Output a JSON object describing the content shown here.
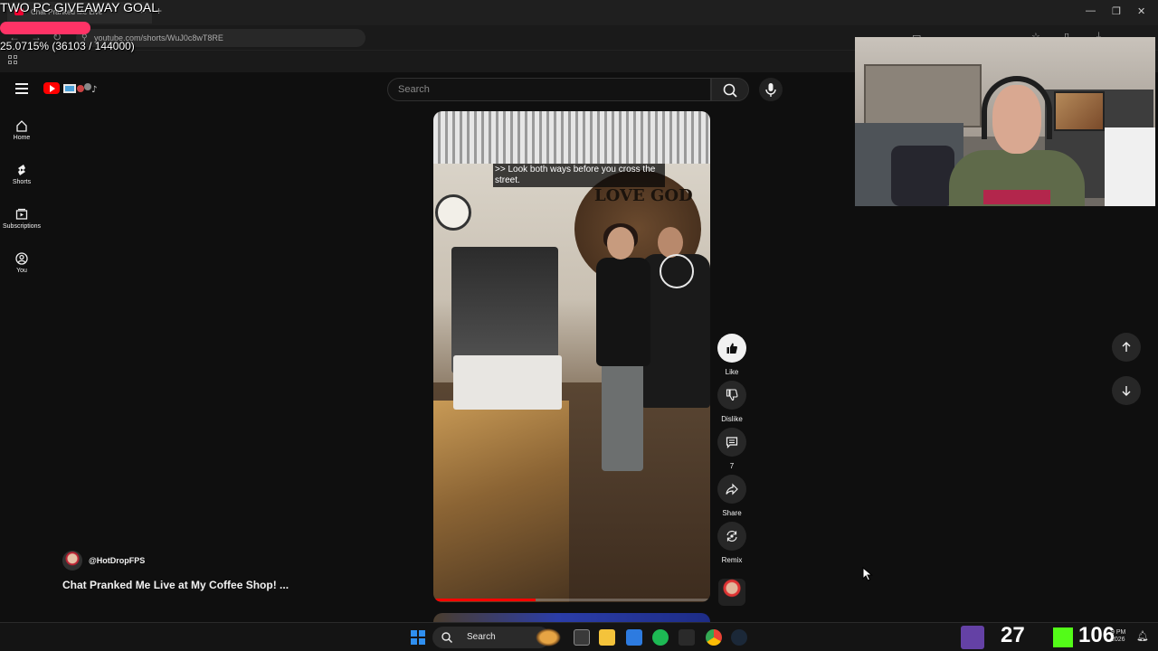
{
  "overlay": {
    "goal_title": "TWO PC GIVEAWAY GOAL",
    "goal_progress_text": "25.0715% (36103 / 144000)",
    "goal_progress_fraction": 0.250715,
    "bar_color": "#ff3366"
  },
  "browser": {
    "tab_title": "Chat Pranked Me Live",
    "url": "youtube.com/shorts/WuJ0c8wT8RE",
    "icons": {
      "back": "back-arrow-icon",
      "forward": "forward-arrow-icon",
      "reload": "reload-icon",
      "apps": "apps-grid-icon"
    }
  },
  "youtube": {
    "search_placeholder": "Search",
    "guide": [
      {
        "label": "Home",
        "icon": "home-icon"
      },
      {
        "label": "Shorts",
        "icon": "shorts-icon"
      },
      {
        "label": "Subscriptions",
        "icon": "subscriptions-icon"
      },
      {
        "label": "You",
        "icon": "account-icon"
      }
    ],
    "short": {
      "caption": ">> Look both ways before you cross the street.",
      "sign_text": "LOVE GOD",
      "progress_fraction": 0.37,
      "channel": "@HotDropFPS",
      "title": "Chat Pranked Me Live at My Coffee Shop! ..."
    },
    "actions": {
      "like": "Like",
      "dislike": "Dislike",
      "comments": "7",
      "share": "Share",
      "remix": "Remix"
    },
    "accent": "#ff0000"
  },
  "taskbar": {
    "search_label": "Search",
    "twitch_count": "27",
    "kick_count": "106",
    "clock_time": "9 PM",
    "clock_date": "2026"
  }
}
